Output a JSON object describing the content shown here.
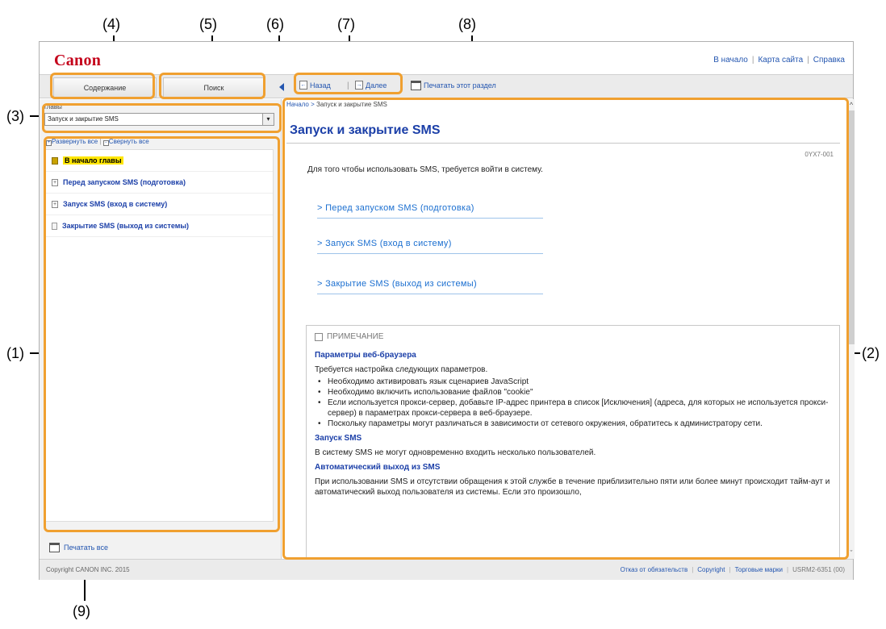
{
  "callouts": [
    "(1)",
    "(2)",
    "(3)",
    "(4)",
    "(5)",
    "(6)",
    "(7)",
    "(8)",
    "(9)"
  ],
  "header": {
    "logo": "Canon",
    "links": [
      "В начало",
      "Карта сайта",
      "Справка"
    ]
  },
  "toolbar": {
    "tab_contents": "Содержание",
    "tab_search": "Поиск",
    "back": "Назад",
    "next": "Далее",
    "print_section": "Печатать этот раздел"
  },
  "sidebar": {
    "chapter_label": "главы",
    "chapter_value": "Запуск и закрытие SMS",
    "expand_all": "Развернуть все",
    "collapse_all": "Свернуть все",
    "items": [
      "В начало главы",
      "Перед запуском SMS (подготовка)",
      "Запуск SMS (вход в систему)",
      "Закрытие SMS (выход из системы)"
    ],
    "print_all": "Печатать все"
  },
  "content": {
    "breadcrumb_home": "Начало",
    "breadcrumb_current": "Запуск и закрытие SMS",
    "title": "Запуск и закрытие SMS",
    "doc_id": "0YX7-001",
    "intro": "Для того чтобы использовать SMS, требуется войти в систему.",
    "links": [
      "> Перед запуском SMS (подготовка)",
      "> Запуск SMS (вход в систему)",
      "> Закрытие SMS (выход из системы)"
    ],
    "note": {
      "heading": "ПРИМЕЧАНИЕ",
      "sub1": "Параметры веб-браузера",
      "p1": "Требуется настройка следующих параметров.",
      "bullets": [
        "Необходимо активировать язык сценариев JavaScript",
        "Необходимо включить использование файлов \"cookie\"",
        "Если используется прокси-сервер, добавьте IP-адрес принтера в список [Исключения] (адреса, для которых не используется прокси-сервер) в параметрах прокси-сервера в веб-браузере.",
        "Поскольку параметры могут различаться в зависимости от сетевого окружения, обратитесь к администратору сети."
      ],
      "sub2": "Запуск SMS",
      "p2": "В систему SMS не могут одновременно входить несколько пользователей.",
      "sub3": "Автоматический выход из SMS",
      "p3": "При использовании SMS и отсутствии обращения к этой службе в течение приблизительно пяти или более минут происходит тайм-аут и автоматический выход пользователя из системы. Если это произошло,"
    }
  },
  "footer": {
    "copyright": "Copyright CANON INC. 2015",
    "links": [
      "Отказ от обязательств",
      "Copyright",
      "Торговые марки"
    ],
    "code": "USRM2-6351 (00)"
  },
  "colors": {
    "highlight": "#f0a030",
    "brand": "#c4001a",
    "link": "#1b3fa8"
  }
}
